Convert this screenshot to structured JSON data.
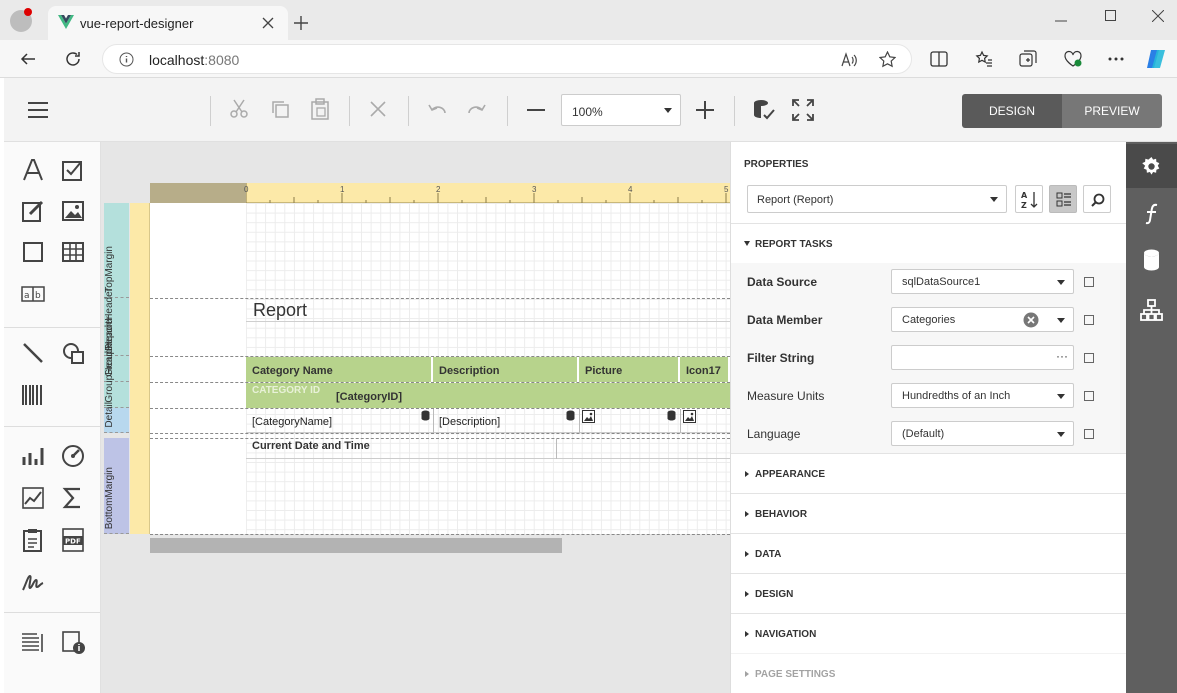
{
  "browser": {
    "tab_title": "vue-report-designer",
    "url": "localhost:8080",
    "url_host": "localhost",
    "url_port": ":8080"
  },
  "toolbar": {
    "zoom": "100%",
    "design_label": "DESIGN",
    "preview_label": "PREVIEW"
  },
  "ruler": {
    "marks": [
      "0",
      "1",
      "2",
      "3",
      "4",
      "5"
    ]
  },
  "bands": [
    {
      "name": "TopMargin"
    },
    {
      "name": "ReportHeader"
    },
    {
      "name": "GroupHeader"
    },
    {
      "name": "GroupHeader"
    },
    {
      "name": "Detail"
    },
    {
      "name": "BottomMargin"
    }
  ],
  "report": {
    "title": "Report",
    "columns": [
      "Category Name",
      "Description",
      "Picture",
      "Icon17"
    ],
    "group_label": "CATEGORY ID",
    "group_field": "[CategoryID]",
    "detail": [
      "[CategoryName]",
      "[Description]"
    ],
    "footer_text": "Current Date and Time"
  },
  "properties": {
    "title": "PROPERTIES",
    "selector": "Report (Report)",
    "report_tasks": "REPORT TASKS",
    "rows": [
      {
        "label": "Data Source",
        "value": "sqlDataSource1"
      },
      {
        "label": "Data Member",
        "value": "Categories"
      },
      {
        "label": "Filter String",
        "value": "",
        "button": "···"
      },
      {
        "label": "Measure Units",
        "value": "Hundredths of an Inch"
      },
      {
        "label": "Language",
        "value": "(Default)"
      }
    ],
    "sections": [
      "APPEARANCE",
      "BEHAVIOR",
      "DATA",
      "DESIGN",
      "NAVIGATION",
      "PAGE SETTINGS"
    ]
  },
  "colors": {
    "accent": "#5a5a5a",
    "band_header": "#b7d38c",
    "ruler": "#fce9a8",
    "rightbar": "#5f5f5f"
  }
}
